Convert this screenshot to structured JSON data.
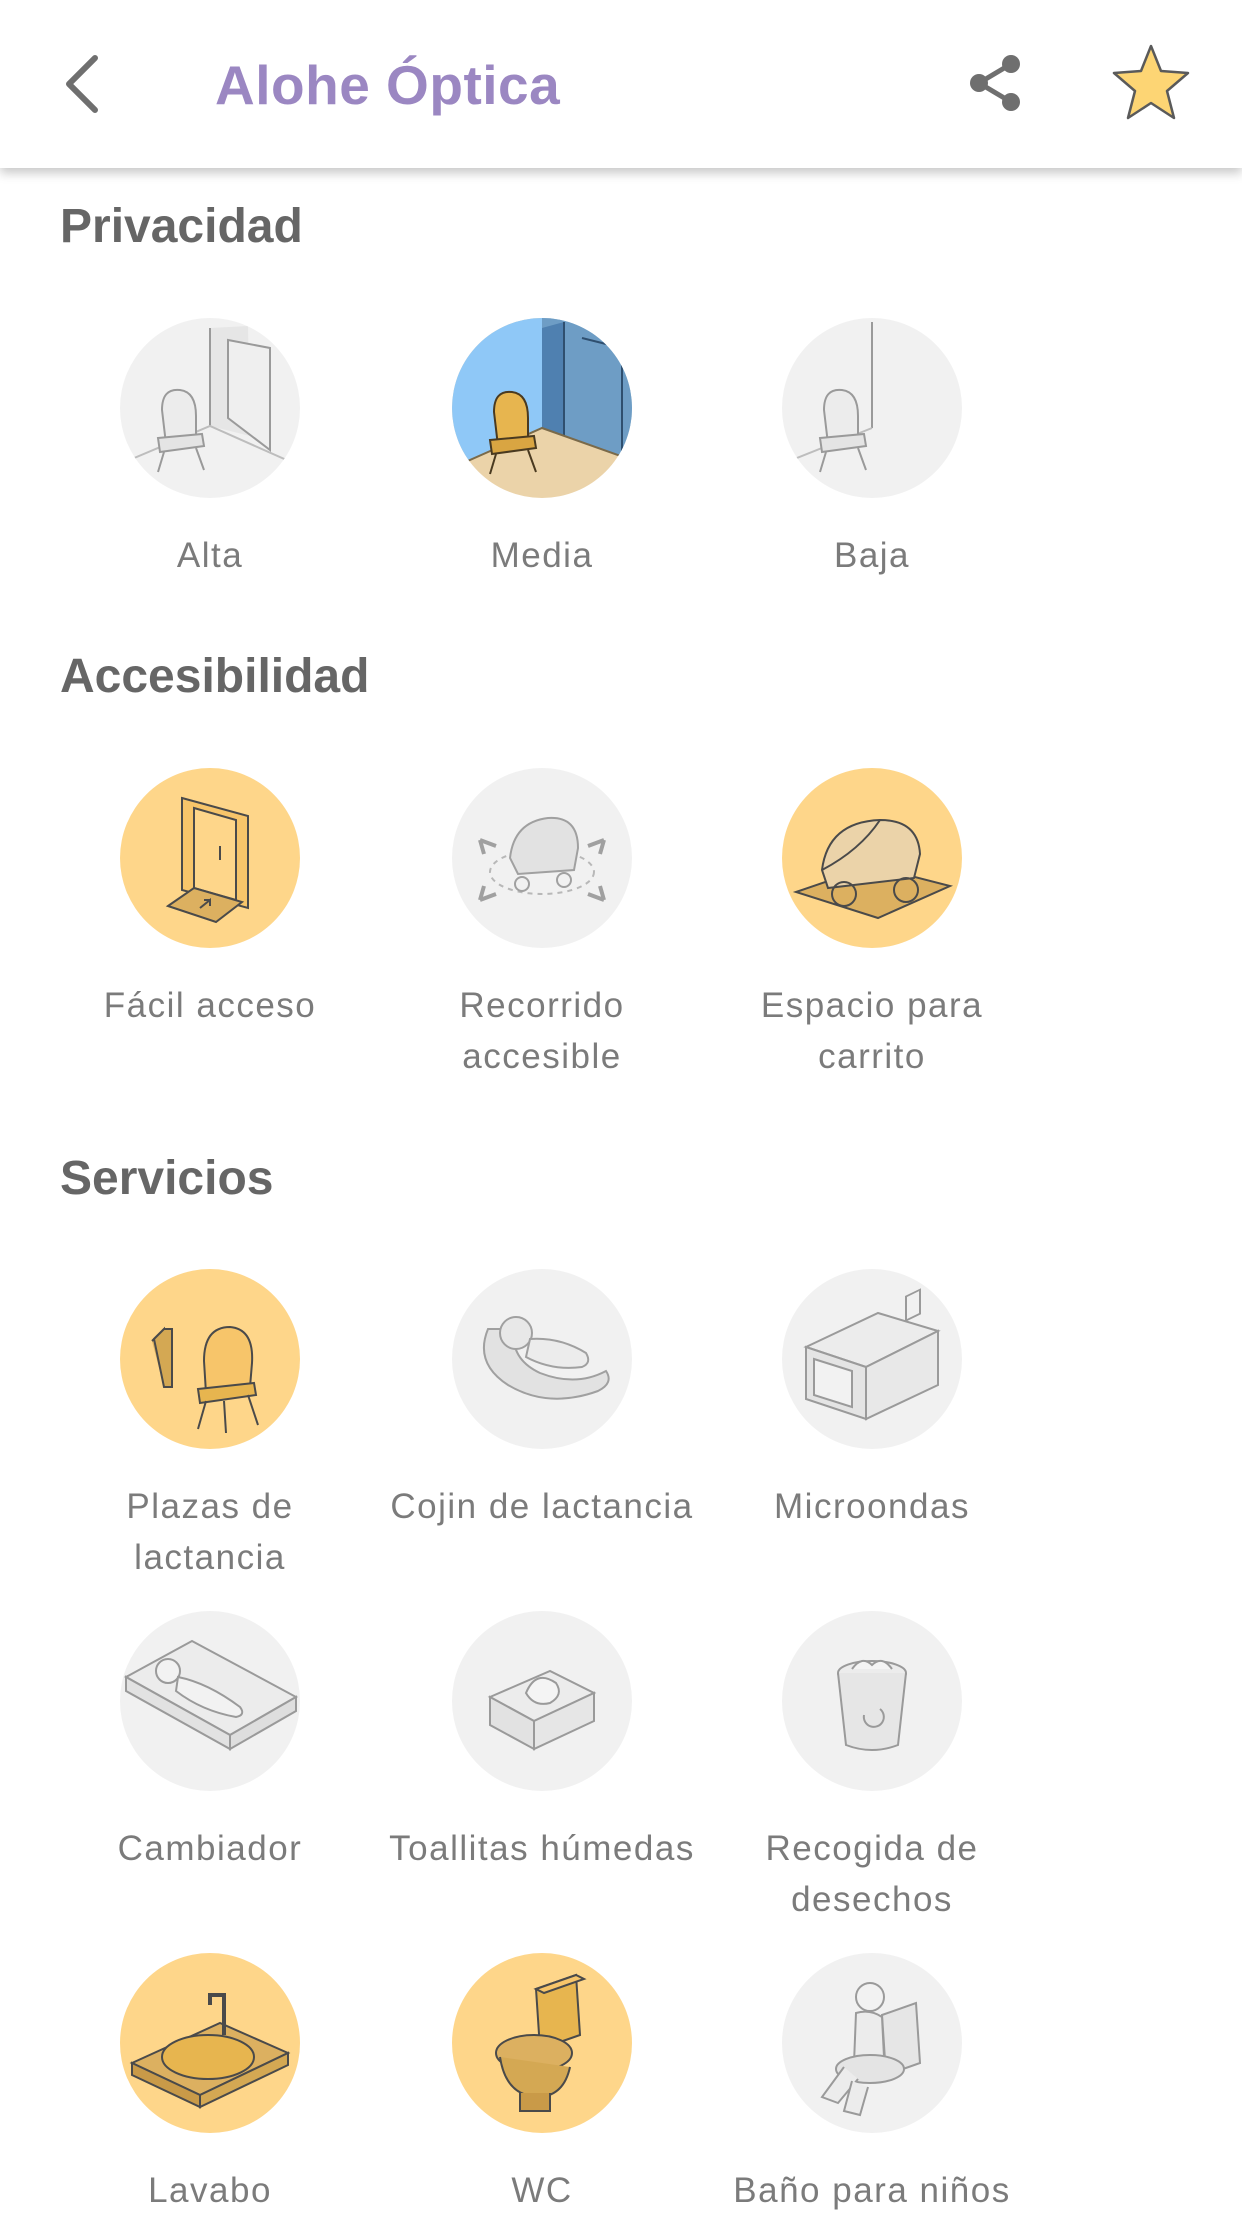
{
  "header": {
    "title": "Alohe Óptica",
    "back_icon": "chevron-left-icon",
    "share_icon": "share-icon",
    "favorite_icon": "star-icon",
    "star_color": "#fdd574",
    "title_color": "#9b87c2"
  },
  "sections": {
    "privacidad": {
      "title": "Privacidad",
      "items": [
        {
          "label": "Alta",
          "state": "inactive"
        },
        {
          "label": "Media",
          "state": "selected"
        },
        {
          "label": "Baja",
          "state": "inactive"
        }
      ]
    },
    "accesibilidad": {
      "title": "Accesibilidad",
      "items": [
        {
          "label": "Fácil acceso",
          "state": "active"
        },
        {
          "label": "Recorrido accesible",
          "state": "inactive"
        },
        {
          "label": "Espacio para carrito",
          "state": "active"
        }
      ]
    },
    "servicios": {
      "title": "Servicios",
      "items": [
        {
          "label": "Plazas de lactancia",
          "state": "active"
        },
        {
          "label": "Cojin de lactancia",
          "state": "inactive"
        },
        {
          "label": "Microondas",
          "state": "inactive"
        },
        {
          "label": "Cambiador",
          "state": "inactive"
        },
        {
          "label": "Toallitas húmedas",
          "state": "inactive"
        },
        {
          "label": "Recogida de desechos",
          "state": "inactive"
        },
        {
          "label": "Lavabo",
          "state": "active"
        },
        {
          "label": "WC",
          "state": "active"
        },
        {
          "label": "Baño para niños",
          "state": "inactive"
        }
      ]
    }
  },
  "colors": {
    "active_bg": "#fed68a",
    "inactive_bg": "#f1f1f1",
    "selected_sky": "#8fc8f7",
    "selected_floor": "#ebd3a9",
    "label_text": "#7b7b7b",
    "section_title": "#666666"
  }
}
